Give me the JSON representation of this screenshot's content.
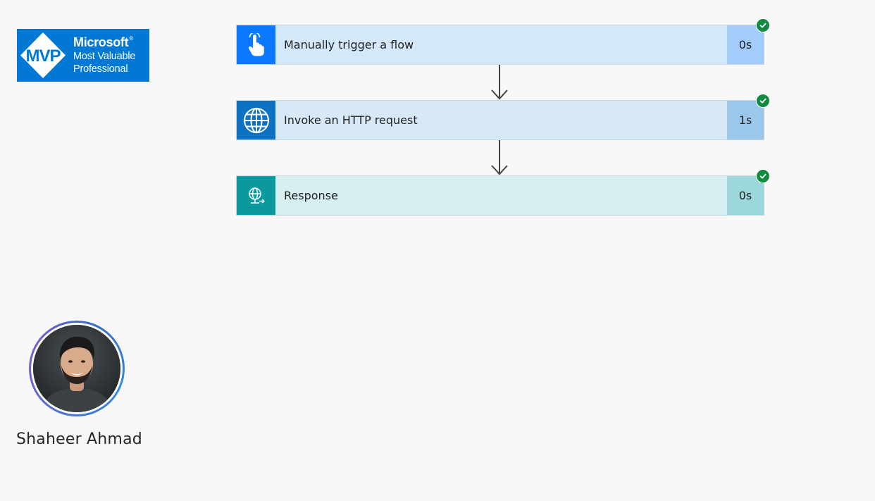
{
  "badge": {
    "brand": "Microsoft",
    "mark": "MVP",
    "line1": "Most Valuable",
    "line2": "Professional",
    "color": "#0078d4"
  },
  "flow": {
    "steps": [
      {
        "label": "Manually trigger a flow",
        "duration": "0s",
        "icon": "hand-pointer-icon",
        "status": "succeeded",
        "accent": "#0a78ff"
      },
      {
        "label": "Invoke an HTTP request",
        "duration": "1s",
        "icon": "globe-icon",
        "status": "succeeded",
        "accent": "#0d72c4"
      },
      {
        "label": "Response",
        "duration": "0s",
        "icon": "globe-response-icon",
        "status": "succeeded",
        "accent": "#0a9a9e"
      }
    ]
  },
  "profile": {
    "name": "Shaheer Ahmad"
  }
}
